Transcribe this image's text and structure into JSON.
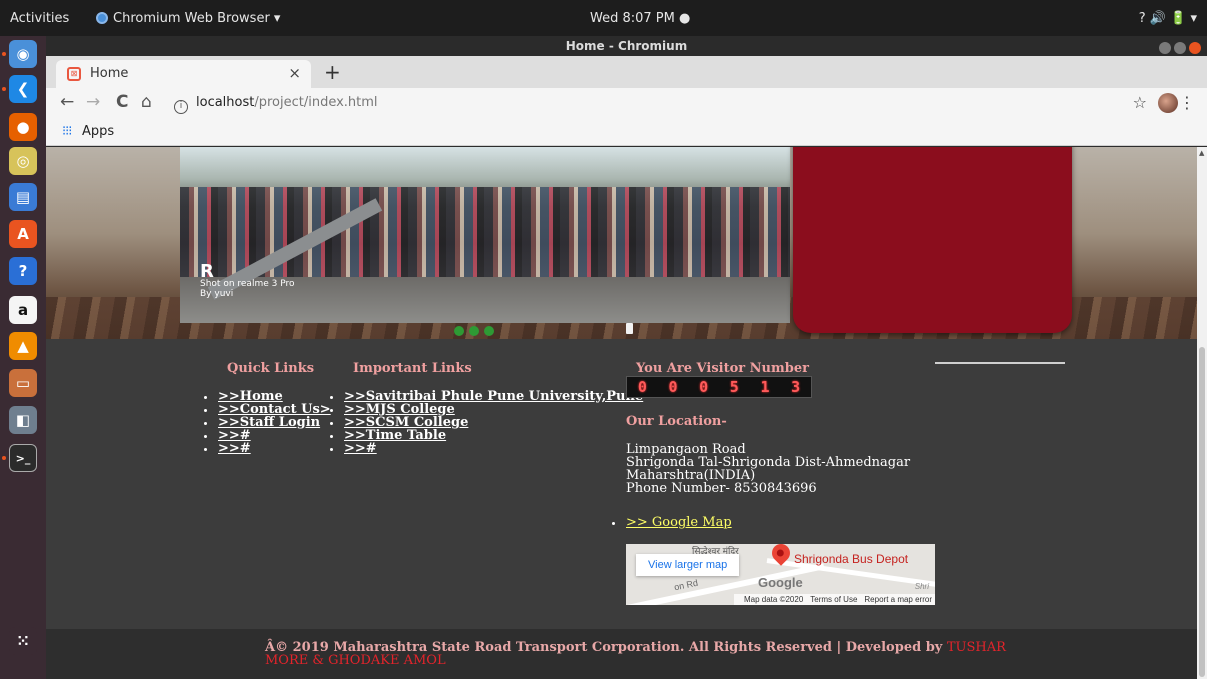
{
  "topbar": {
    "activities": "Activities",
    "app_name": "Chromium Web Browser ▾",
    "clock": "Wed  8:07 PM ●",
    "tray": "?   🔊   🔋 ▾"
  },
  "window": {
    "title": "Home - Chromium"
  },
  "browser": {
    "tab_title": "Home",
    "tab_close": "×",
    "new_tab": "+",
    "back": "←",
    "forward": "→",
    "reload": "C",
    "home": "⌂",
    "url_host": "localhost",
    "url_path": "/project/index.html",
    "star": "☆",
    "menu": "⋮",
    "apps_icon": "⁝⁝⁝",
    "apps_label": "Apps"
  },
  "dock": {
    "items": [
      {
        "name": "chromium-icon",
        "glyph": "◉",
        "color": "#4a90d9"
      },
      {
        "name": "vscode-icon",
        "glyph": "❮",
        "color": "#1e88e5"
      },
      {
        "name": "firefox-icon",
        "glyph": "●",
        "color": "#e66000"
      },
      {
        "name": "disk-icon",
        "glyph": "◎",
        "color": "#d7c35a"
      },
      {
        "name": "document-icon",
        "glyph": "▤",
        "color": "#3a7bd5"
      },
      {
        "name": "software-center-icon",
        "glyph": "A",
        "color": "#e95420"
      },
      {
        "name": "help-icon",
        "glyph": "?",
        "color": "#2a6fd6"
      },
      {
        "name": "amazon-icon",
        "glyph": "a",
        "color": "#f5f5f5"
      },
      {
        "name": "vlc-icon",
        "glyph": "▲",
        "color": "#f08c00"
      },
      {
        "name": "files-icon",
        "glyph": "▭",
        "color": "#c9703b"
      },
      {
        "name": "image-viewer-icon",
        "glyph": "◧",
        "color": "#6f7f8f"
      },
      {
        "name": "terminal-icon",
        "glyph": ">_",
        "color": "#2b2b2b"
      },
      {
        "name": "app-grid-icon",
        "glyph": "⁙",
        "color": "#3a2b33"
      }
    ]
  },
  "slider": {
    "watermark_logo": "R",
    "watermark_line1": "Shot on realme 3 Pro",
    "watermark_line2": "By yuvi",
    "colors": {
      "panel": "#8b0d1d",
      "dot": "#2e9a34"
    }
  },
  "footer": {
    "quick_links": {
      "heading": "Quick Links",
      "items": [
        ">>Home",
        ">>Contact Us>",
        ">>Staff Login",
        ">>#",
        ">>#"
      ]
    },
    "important_links": {
      "heading": "Important Links",
      "items": [
        ">>Savitribai Phule Pune University,Pune",
        ">>MJS College",
        ">>SCSM College",
        ">>Time Table",
        ">>#"
      ]
    },
    "visitor": {
      "heading": "You Are Visitor Number",
      "digits": [
        "0",
        "0",
        "0",
        "5",
        "1",
        "3"
      ]
    },
    "location": {
      "heading": "Our Location-",
      "line1": "Limpangaon Road",
      "line2": "Shrigonda Tal-Shrigonda Dist-Ahmednagar",
      "line3": "Maharshtra(INDIA)",
      "line4": "Phone Number- 8530843696",
      "map_link": ">> Google Map"
    },
    "map": {
      "view_larger": "View larger map",
      "place": "Shrigonda Bus Depot",
      "top_label": "सिद्धेश्वर मंदिर",
      "road_label": "on Rd",
      "road_label2": "Shri",
      "google": "Google",
      "attribution": "Map data ©2020",
      "terms": "Terms of Use",
      "report": "Report a map error"
    },
    "copyright": "Â© 2019 Maharashtra State Road Transport Corporation. All Rights Reserved | Developed by ",
    "developer": "TUSHAR MORE & GHODAKE AMOL"
  }
}
